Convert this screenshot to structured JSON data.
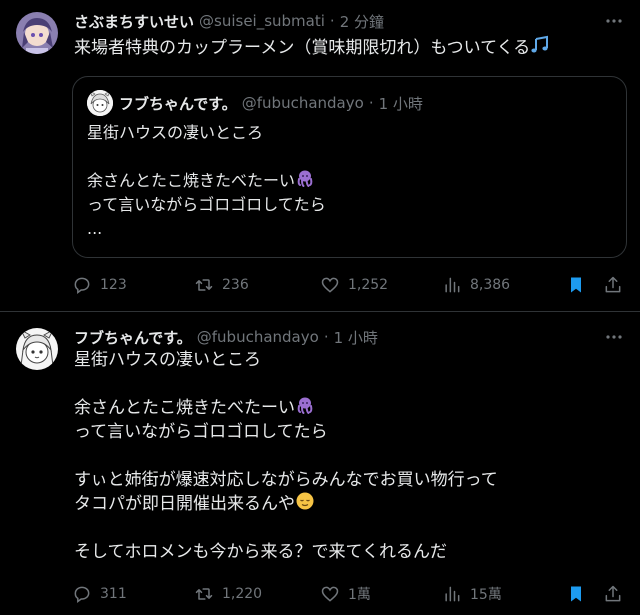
{
  "tweets": [
    {
      "author_name": "さぶまちすいせい",
      "handle": "@suisei_submati",
      "sep": "·",
      "time": "2 分鐘",
      "text_lines": [
        "来場者特典のカップラーメン（賞味期限切れ）もついてくる"
      ],
      "quote": {
        "author_name": "フブちゃんです。",
        "handle": "@fubuchandayo",
        "sep": "·",
        "time": "1 小時",
        "text_lines": [
          "星街ハウスの凄いところ",
          "",
          "余さんとたこ焼きたべたーい",
          "って言いながらゴロゴロしてたら",
          "..."
        ]
      },
      "actions": {
        "reply": "123",
        "retweet": "236",
        "like": "1,252",
        "views": "8,386"
      }
    },
    {
      "author_name": "フブちゃんです。",
      "handle": "@fubuchandayo",
      "sep": "·",
      "time": "1 小時",
      "text_lines": [
        "星街ハウスの凄いところ",
        "",
        "余さんとたこ焼きたべたーい",
        "って言いながらゴロゴロしてたら",
        "",
        "すぃと姉街が爆速対応しながらみんなでお買い物行って",
        "タコパが即日開催出来るんや",
        "",
        "そしてホロメンも今から来る？で来てくれるんだ"
      ],
      "actions": {
        "reply": "311",
        "retweet": "1,220",
        "like": "1萬",
        "views": "15萬"
      }
    }
  ],
  "colors": {
    "bg": "#000000",
    "text": "#e7e9ea",
    "muted": "#71767b",
    "border": "#2f3336",
    "bookmark": "#1d9bf0"
  },
  "icons": [
    "avatar-image",
    "more-icon",
    "music-notes-emoji",
    "octopus-emoji",
    "relieved-face-emoji",
    "reply-icon",
    "retweet-icon",
    "like-icon",
    "views-icon",
    "bookmark-icon",
    "share-icon"
  ]
}
